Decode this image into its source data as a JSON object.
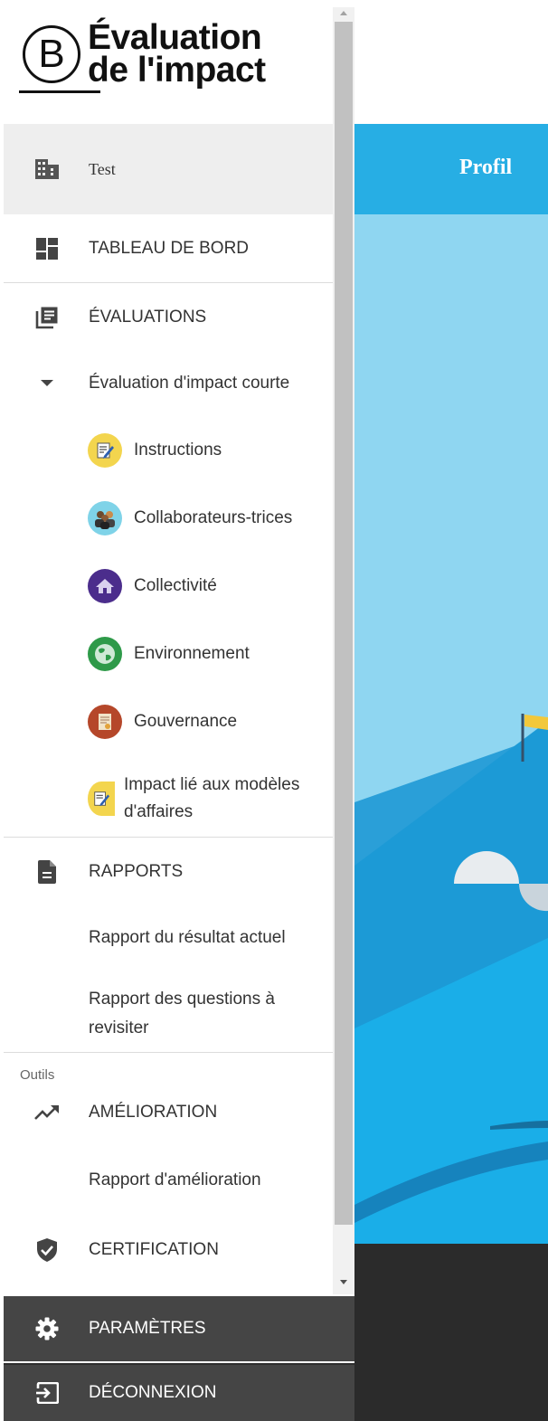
{
  "logo": {
    "mark": "B",
    "line1": "Évaluation",
    "line2": "de l'impact"
  },
  "sidebar": {
    "org_item": {
      "label": "Test",
      "icon": "building-icon"
    },
    "dashboard": {
      "label": "TABLEAU DE BORD",
      "icon": "dashboard-icon"
    },
    "evaluations": {
      "label": "ÉVALUATIONS",
      "icon": "list-icon"
    },
    "evaluation_group": {
      "label": "Évaluation d'impact courte",
      "icon": "caret-down-icon"
    },
    "evaluation_sections": [
      {
        "label": "Instructions",
        "icon": "instructions-icon",
        "color": "#f3d54e"
      },
      {
        "label": "Collaborateurs-trices",
        "icon": "workers-icon",
        "color": "#7fd3e8"
      },
      {
        "label": "Collectivité",
        "icon": "community-icon",
        "color": "#4b2d8c"
      },
      {
        "label": "Environnement",
        "icon": "environment-icon",
        "color": "#2e9a49"
      },
      {
        "label": "Gouvernance",
        "icon": "governance-icon",
        "color": "#b5472a"
      },
      {
        "label_line1": "Impact lié aux modèles",
        "label_line2": "d'affaires",
        "icon": "business-model-icon",
        "color": "#f3d54e"
      }
    ],
    "reports": {
      "label": "RAPPORTS",
      "icon": "document-icon"
    },
    "report_items": [
      {
        "label": "Rapport du résultat actuel"
      },
      {
        "label_line1": "Rapport des questions à",
        "label_line2": "revisiter"
      }
    ],
    "tools_label": "Outils",
    "improvement": {
      "label": "AMÉLIORATION",
      "icon": "trending-up-icon"
    },
    "improvement_report": {
      "label": "Rapport d'amélioration"
    },
    "certification": {
      "label": "CERTIFICATION",
      "icon": "shield-check-icon"
    },
    "settings": {
      "label": "PARAMÈTRES",
      "icon": "gear-icon"
    },
    "logout": {
      "label": "DÉCONNEXION",
      "icon": "logout-icon"
    }
  },
  "main": {
    "header_title": "Profil"
  },
  "colors": {
    "header_blue": "#27aee4",
    "hero_blue": "#8fd6f1",
    "sidebar_dark": "#454545",
    "active_bg": "#eeeeee"
  }
}
